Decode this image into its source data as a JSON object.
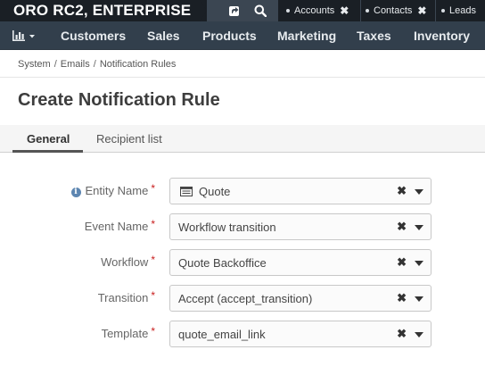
{
  "app": {
    "title": "ORO RC2, ENTERPRISE"
  },
  "topbar": {
    "icons": [
      "share-icon",
      "search-icon"
    ],
    "pins": [
      {
        "label": "Accounts",
        "closable": true
      },
      {
        "label": "Contacts",
        "closable": true
      },
      {
        "label": "Leads",
        "closable": false
      }
    ],
    "close_glyph": "✖"
  },
  "menu": {
    "dashboard_icon": "bar-chart-icon",
    "items": [
      "Customers",
      "Sales",
      "Products",
      "Marketing",
      "Taxes",
      "Inventory"
    ]
  },
  "breadcrumb": {
    "items": [
      "System",
      "Emails",
      "Notification Rules"
    ],
    "separator": "/"
  },
  "page": {
    "title": "Create Notification Rule"
  },
  "tabs": {
    "items": [
      "General",
      "Recipient list"
    ],
    "active": "General"
  },
  "form": {
    "required_mark": "*",
    "fields": [
      {
        "label": "Entity Name",
        "value": "Quote",
        "has_info_icon": true,
        "value_icon": "entity-list-icon"
      },
      {
        "label": "Event Name",
        "value": "Workflow transition"
      },
      {
        "label": "Workflow",
        "value": "Quote Backoffice"
      },
      {
        "label": "Transition",
        "value": "Accept (accept_transition)"
      },
      {
        "label": "Template",
        "value": "quote_email_link"
      }
    ],
    "clear_glyph": "✖"
  },
  "colors": {
    "topbar_bg": "#1a1f25",
    "menubar_bg": "#323f4c",
    "required": "#c81d1d",
    "info": "#5d86b1"
  }
}
